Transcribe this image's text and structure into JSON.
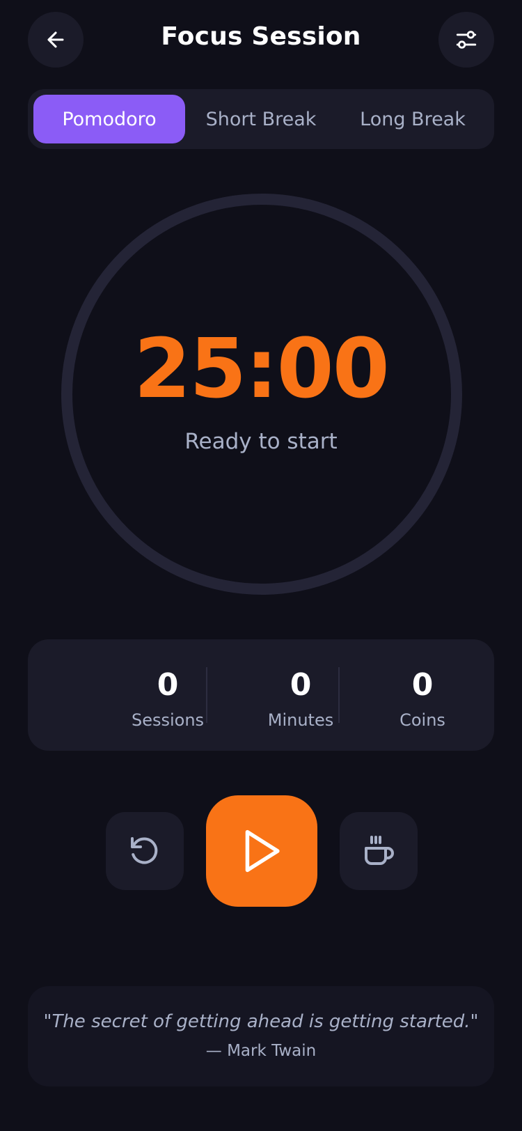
{
  "header": {
    "title": "Focus Session",
    "back_icon": "arrow-left-icon",
    "settings_icon": "sliders-icon"
  },
  "modes": {
    "selected": "Pomodoro",
    "items": [
      {
        "label": "Pomodoro"
      },
      {
        "label": "Short Break"
      },
      {
        "label": "Long Break"
      }
    ]
  },
  "timer": {
    "value": "25:00",
    "status": "Ready to start",
    "progress": 0
  },
  "stats": {
    "sessions": {
      "value": "0",
      "label": "Sessions"
    },
    "minutes": {
      "value": "0",
      "label": "Minutes"
    },
    "coins": {
      "value": "0",
      "label": "Coins"
    }
  },
  "controls": {
    "reset_icon": "rotate-ccw-icon",
    "play_icon": "play-icon",
    "break_icon": "coffee-icon"
  },
  "quote": {
    "text": "\"The secret of getting ahead is getting started.\"",
    "author": "— Mark Twain"
  },
  "colors": {
    "background": "#0f0f19",
    "surface": "#1b1b29",
    "accent_purple": "#8b5cf6",
    "accent_orange": "#f97316",
    "muted_text": "#a9b1c8",
    "ring_track": "#242436"
  }
}
